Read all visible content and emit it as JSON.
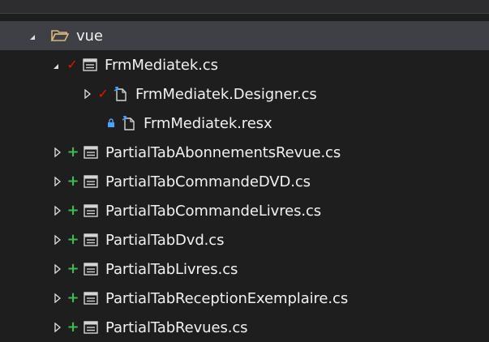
{
  "solution_explorer": {
    "items": [
      {
        "label": "vue",
        "icon": "folder-open-icon",
        "status": "none",
        "expander": "expanded"
      },
      {
        "label": "FrmMediatek.cs",
        "icon": "form-icon",
        "status": "checked-out",
        "expander": "expanded"
      },
      {
        "label": "FrmMediatek.Designer.cs",
        "icon": "designer-file-icon",
        "status": "checked-out",
        "expander": "collapsed"
      },
      {
        "label": "FrmMediatek.resx",
        "icon": "resource-file-icon",
        "status": "locked",
        "expander": "none"
      },
      {
        "label": "PartialTabAbonnementsRevue.cs",
        "icon": "form-icon",
        "status": "added",
        "expander": "collapsed"
      },
      {
        "label": "PartialTabCommandeDVD.cs",
        "icon": "form-icon",
        "status": "added",
        "expander": "collapsed"
      },
      {
        "label": "PartialTabCommandeLivres.cs",
        "icon": "form-icon",
        "status": "added",
        "expander": "collapsed"
      },
      {
        "label": "PartialTabDvd.cs",
        "icon": "form-icon",
        "status": "added",
        "expander": "collapsed"
      },
      {
        "label": "PartialTabLivres.cs",
        "icon": "form-icon",
        "status": "added",
        "expander": "collapsed"
      },
      {
        "label": "PartialTabReceptionExemplaire.cs",
        "icon": "form-icon",
        "status": "added",
        "expander": "collapsed"
      },
      {
        "label": "PartialTabRevues.cs",
        "icon": "form-icon",
        "status": "added",
        "expander": "collapsed"
      }
    ]
  },
  "colors": {
    "background": "#1e1e1e",
    "selected_row": "#3f3f46",
    "text": "#f1f1f1",
    "folder": "#dcb67a",
    "checked_out": "#e51400",
    "added": "#3fb950",
    "locked": "#4aa3ff"
  }
}
